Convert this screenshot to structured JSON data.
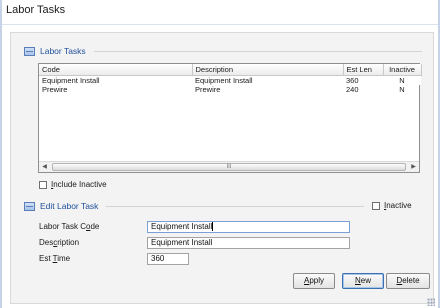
{
  "window": {
    "title": "Labor Tasks"
  },
  "list_section": {
    "title": "Labor Tasks"
  },
  "grid": {
    "columns": [
      "Code",
      "Description",
      "Est Len",
      "Inactive"
    ],
    "rows": [
      {
        "code": "Equipment Install",
        "description": "Equipment Install",
        "est_len": "360",
        "inactive": "N"
      },
      {
        "code": "Prewire",
        "description": "Prewire",
        "est_len": "240",
        "inactive": "N"
      }
    ],
    "scroll_grip": "III"
  },
  "include_inactive": {
    "label_pre": "",
    "accel": "I",
    "label_post": "nclude Inactive",
    "checked": false
  },
  "edit_section": {
    "title": "Edit Labor Task"
  },
  "edit_inactive": {
    "accel": "I",
    "label_post": "nactive",
    "checked": false
  },
  "form": {
    "code": {
      "label_pre": "Labor Task C",
      "accel": "o",
      "label_post": "de",
      "value": "Equipment Install"
    },
    "description": {
      "label_pre": "Des",
      "accel": "c",
      "label_post": "ription",
      "value": "Equipment Install"
    },
    "est_time": {
      "label_pre": "Est ",
      "accel": "T",
      "label_post": "ime",
      "value": "360"
    }
  },
  "buttons": {
    "apply": {
      "accel": "A",
      "rest": "pply"
    },
    "new": {
      "accel": "N",
      "rest": "ew"
    },
    "delete": {
      "accel": "D",
      "rest": "elete"
    }
  },
  "colors": {
    "section_title": "#1f4f9a",
    "accent_border": "#3a6fb0"
  }
}
